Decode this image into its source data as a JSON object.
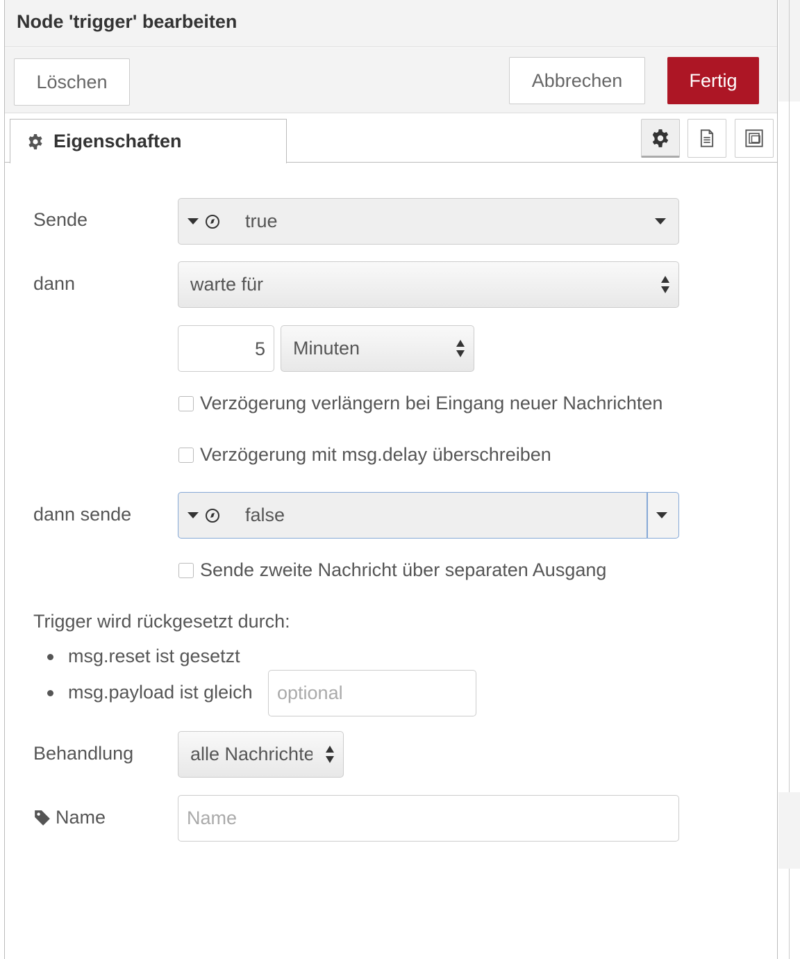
{
  "dialog": {
    "title": "Node 'trigger' bearbeiten",
    "buttons": {
      "delete": "Löschen",
      "cancel": "Abbrechen",
      "done": "Fertig"
    },
    "accent_color": "#ad1625"
  },
  "tabs": {
    "properties": {
      "label": "Eigenschaften",
      "icon": "gear-icon"
    },
    "tools": [
      "gear-icon",
      "document-icon",
      "frame-icon"
    ]
  },
  "form": {
    "send": {
      "label": "Sende",
      "type_icon": "boolean-icon",
      "value": "true"
    },
    "then": {
      "label": "dann",
      "value": "warte für"
    },
    "duration": {
      "value": "5",
      "unit": "Minuten"
    },
    "extend_delay": {
      "label": "Verzögerung verlängern bei Eingang neuer Nachrichten",
      "checked": false
    },
    "override_delay": {
      "label": "Verzögerung mit msg.delay überschreiben",
      "checked": false
    },
    "then_send": {
      "label": "dann sende",
      "type_icon": "boolean-icon",
      "value": "false"
    },
    "second_output": {
      "label": "Sende zweite Nachricht über separaten Ausgang",
      "checked": false
    },
    "reset": {
      "heading": "Trigger wird rückgesetzt durch:",
      "items": [
        "msg.reset ist gesetzt",
        "msg.payload ist gleich"
      ],
      "payload_placeholder": "optional"
    },
    "handling": {
      "label": "Behandlung",
      "value": "alle Nachrichten"
    },
    "name": {
      "label": "Name",
      "placeholder": "Name"
    }
  }
}
